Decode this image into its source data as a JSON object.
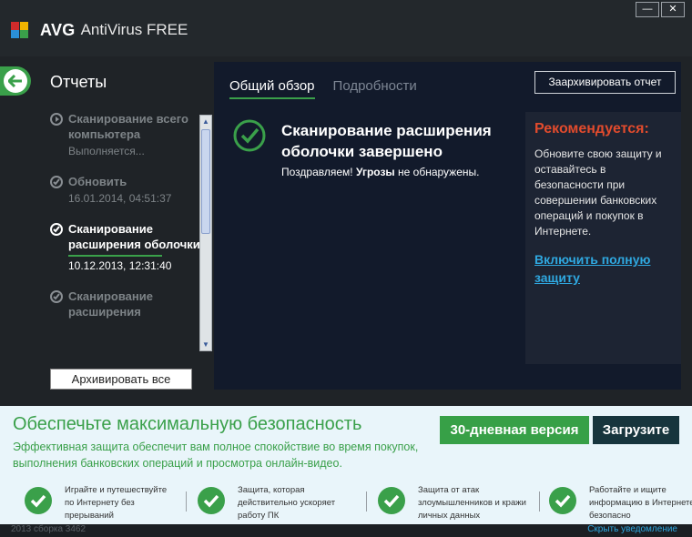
{
  "window": {
    "brand": "AVG",
    "product": "AntiVirus FREE",
    "minimize": "—",
    "close": "✕"
  },
  "sidebar": {
    "title": "Отчеты",
    "reports": [
      {
        "title": "Сканирование всего компьютера",
        "subtitle": "Выполняется...",
        "icon": "play-circle-icon"
      },
      {
        "title": "Обновить",
        "subtitle": "16.01.2014, 04:51:37",
        "icon": "check-circle-icon"
      },
      {
        "title": "Сканирование расширения оболочки",
        "subtitle": "10.12.2013, 12:31:40",
        "icon": "check-circle-icon"
      },
      {
        "title": "Сканирование расширения",
        "subtitle": "",
        "icon": "check-circle-icon"
      }
    ],
    "archive_all": "Архивировать все"
  },
  "main": {
    "tabs": [
      "Общий обзор",
      "Подробности"
    ],
    "archive_report": "Заархивировать отчет",
    "result_title": "Сканирование расширения оболочки завершено",
    "result_msg_pre": "Поздравляем! ",
    "result_msg_bold": "Угрозы",
    "result_msg_post": " не обнаружены.",
    "recommend": {
      "heading": "Рекомендуется:",
      "body": "Обновите свою защиту и оставайтесь в безопасности при совершении банковских операций и покупок в Интернете.",
      "link": "Включить полную защиту"
    }
  },
  "banner": {
    "title": "Обеспечьте максимальную безопасность",
    "description": "Эффективная защита обеспечит вам полное спокойствие во время покупок, выполнения банковских операций и просмотра онлайн-видео.",
    "trial_button": "30-дневная версия",
    "download_button": "Загрузите",
    "features": [
      "Играйте и путешествуйте по Интернету без прерываний",
      "Защита, которая действительно ускоряет работу ПК",
      "Защита от атак злоумышленников и кражи личных данных",
      "Работайте и ищите информацию в Интернете безопасно"
    ]
  },
  "statusbar": {
    "build": "2013  сборка 3462",
    "hide_notification": "Скрыть уведомление"
  },
  "colors": {
    "accent_green": "#3aa04a",
    "recommend_red": "#e24b2d",
    "link_blue": "#2fa8e0"
  }
}
